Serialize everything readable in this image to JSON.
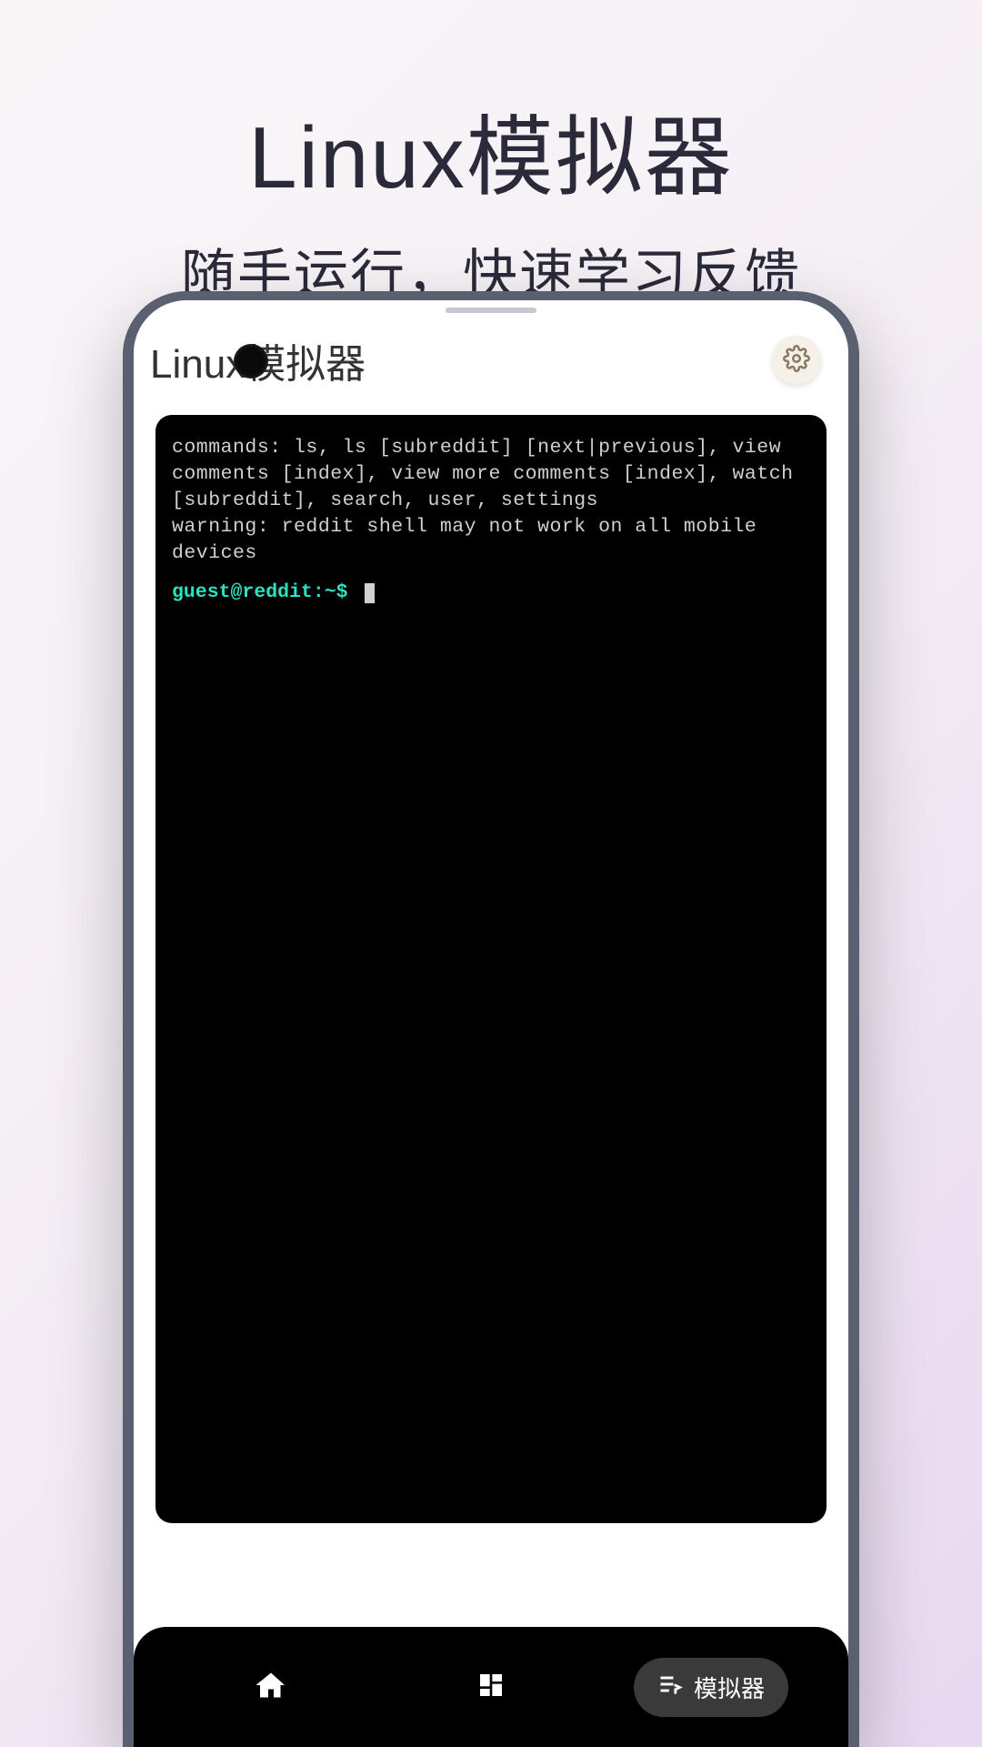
{
  "hero": {
    "title": "Linux模拟器",
    "subtitle": "随手运行，快速学习反馈"
  },
  "app": {
    "title": "Linux模拟器"
  },
  "terminal": {
    "line1": "commands: ls, ls [subreddit] [next|previous], view comments [index], view more comments [index], watch [subreddit], search, user, settings",
    "line2": "warning: reddit shell may not work on all mobile devices",
    "prompt": "guest@reddit:~$"
  },
  "nav": {
    "emulator_label": "模拟器"
  }
}
